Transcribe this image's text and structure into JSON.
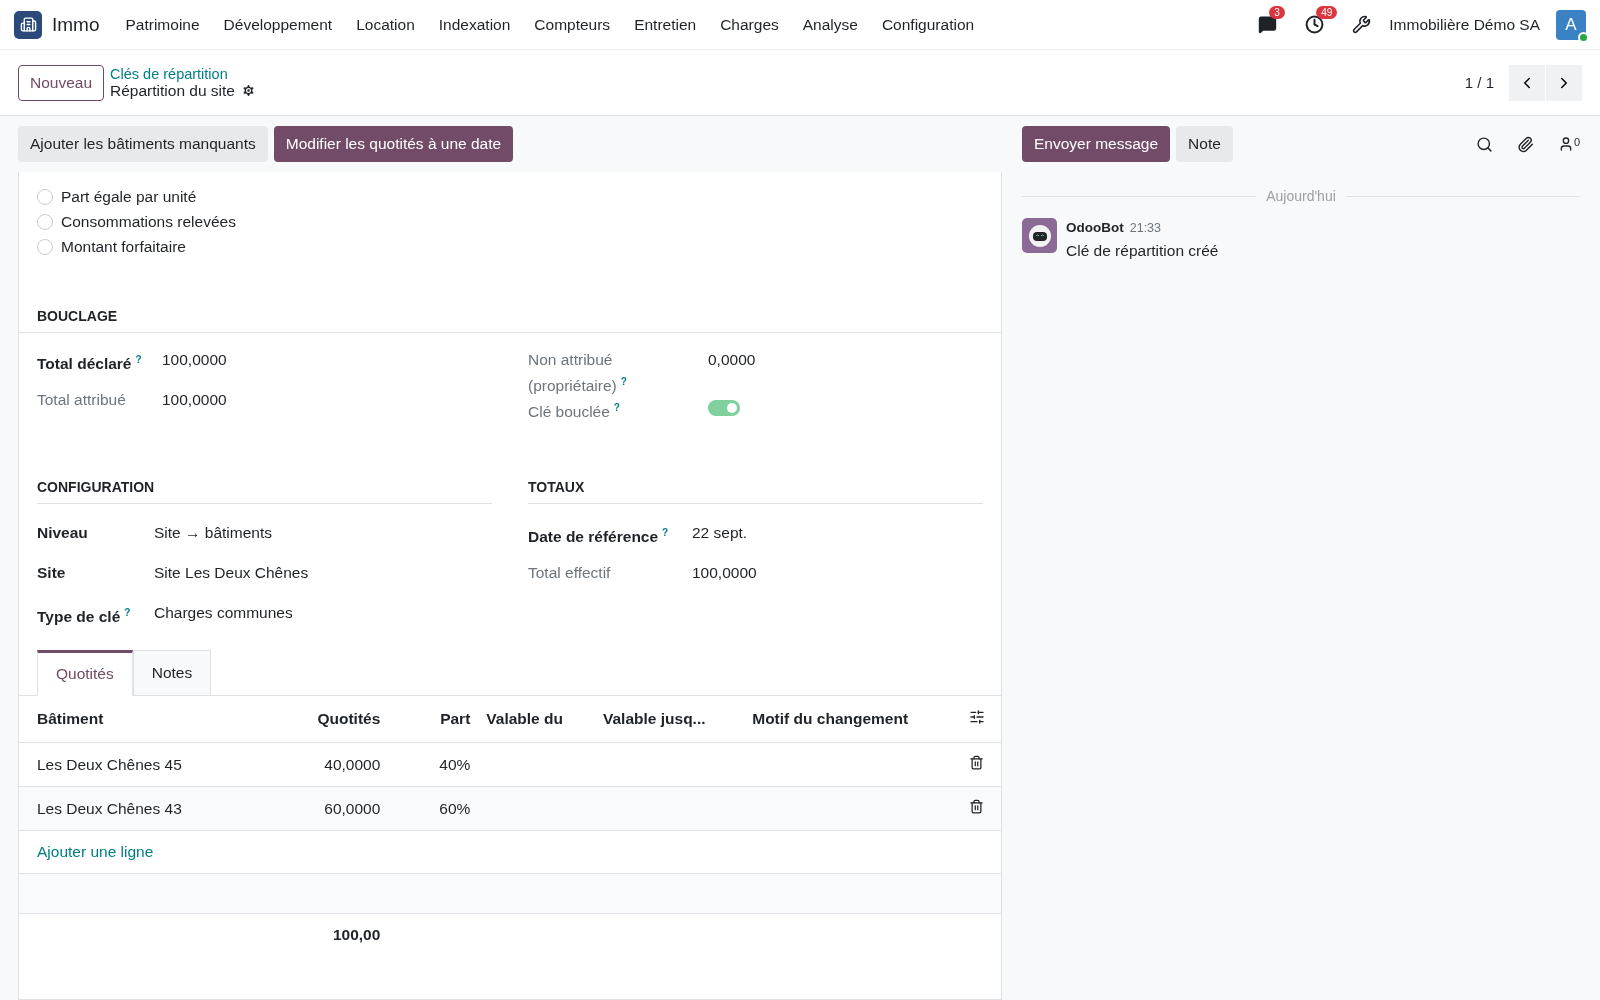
{
  "navbar": {
    "app_name": "Immo",
    "menu": [
      "Patrimoine",
      "Développement",
      "Location",
      "Indexation",
      "Compteurs",
      "Entretien",
      "Charges",
      "Analyse",
      "Configuration"
    ],
    "messages_count": "3",
    "activities_count": "49",
    "company": "Immobilière Démo SA",
    "avatar_letter": "A"
  },
  "control_panel": {
    "new_button": "Nouveau",
    "breadcrumb": "Clés de répartition",
    "record_title": "Répartition du site",
    "pager": "1 / 1"
  },
  "action_bar": {
    "buttons": [
      {
        "label": "Ajouter les bâtiments manquants",
        "primary": false
      },
      {
        "label": "Modifier les quotités à une date",
        "primary": true
      }
    ]
  },
  "chatter_bar": {
    "buttons": [
      {
        "label": "Envoyer message",
        "primary": true
      },
      {
        "label": "Note",
        "primary": false
      }
    ],
    "followers_count": "0"
  },
  "method_options": [
    {
      "label": "Part égale par unité",
      "selected": false
    },
    {
      "label": "Consommations relevées",
      "selected": false
    },
    {
      "label": "Montant forfaitaire",
      "selected": false
    }
  ],
  "bouclage": {
    "title": "BOUCLAGE",
    "left": [
      {
        "label": "Total déclaré",
        "help": "?",
        "value": "100,0000",
        "strong": true
      },
      {
        "label": "Total attribué",
        "value": "100,0000",
        "strong": false
      }
    ],
    "right": [
      {
        "kind": "text",
        "label": "Non attribué (propriétaire)",
        "help": "?",
        "value": "0,0000",
        "strong": false
      },
      {
        "kind": "toggle",
        "label": "Clé bouclée",
        "help": "?",
        "on": true,
        "strong": false
      }
    ]
  },
  "configuration": {
    "title": "CONFIGURATION",
    "fields": [
      {
        "label": "Niveau",
        "value": "Site → bâtiments",
        "strong": true
      },
      {
        "label": "Site",
        "value": "Site Les Deux Chênes",
        "strong": true
      },
      {
        "label": "Type de clé",
        "help": "?",
        "value": "Charges communes",
        "strong": true
      }
    ]
  },
  "totaux": {
    "title": "TOTAUX",
    "fields": [
      {
        "label": "Date de référence",
        "help": "?",
        "value": "22 sept.",
        "strong": true
      },
      {
        "label": "Total effectif",
        "value": "100,0000",
        "strong": false
      }
    ]
  },
  "tabs": [
    {
      "label": "Quotités",
      "selected": true
    },
    {
      "label": "Notes",
      "selected": false
    }
  ],
  "table": {
    "columns": [
      "Bâtiment",
      "Quotités",
      "Part",
      "Valable du",
      "Valable jusq...",
      "Motif du changement"
    ],
    "rows": [
      {
        "building": "Les Deux Chênes 45",
        "quota": "40,0000",
        "share": "40%"
      },
      {
        "building": "Les Deux Chênes 43",
        "quota": "60,0000",
        "share": "60%"
      }
    ],
    "add_line": "Ajouter une ligne",
    "total": "100,00"
  },
  "chatter": {
    "date_separator": "Aujourd'hui",
    "messages": [
      {
        "author": "OdooBot",
        "time": "21:33",
        "body": "Clé de répartition créé"
      }
    ]
  }
}
